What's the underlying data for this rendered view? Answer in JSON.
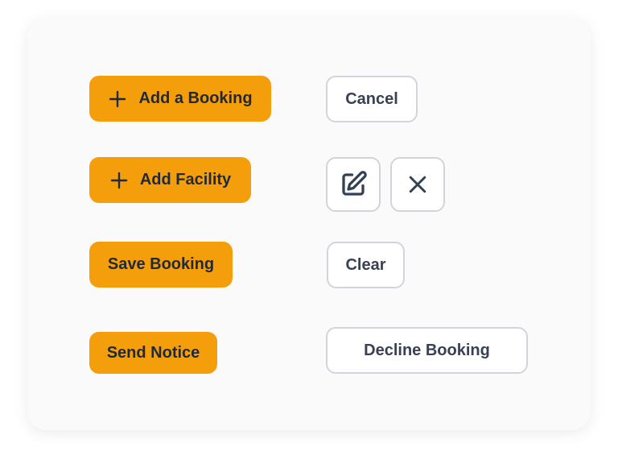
{
  "primary_buttons": {
    "add_booking": "Add a Booking",
    "add_facility": "Add Facility",
    "save_booking": "Save Booking",
    "send_notice": "Send Notice"
  },
  "secondary_buttons": {
    "cancel": "Cancel",
    "clear": "Clear",
    "decline_booking": "Decline Booking"
  },
  "icons": {
    "add_booking_icon": "plus-icon",
    "add_facility_icon": "plus-icon",
    "edit_icon": "edit-icon",
    "close_icon": "close-icon"
  },
  "colors": {
    "primary": "#f59e0b",
    "primary_text": "#1f2937",
    "secondary_border": "#d1d5db",
    "secondary_text": "#374151",
    "card_background": "#fafafa"
  }
}
